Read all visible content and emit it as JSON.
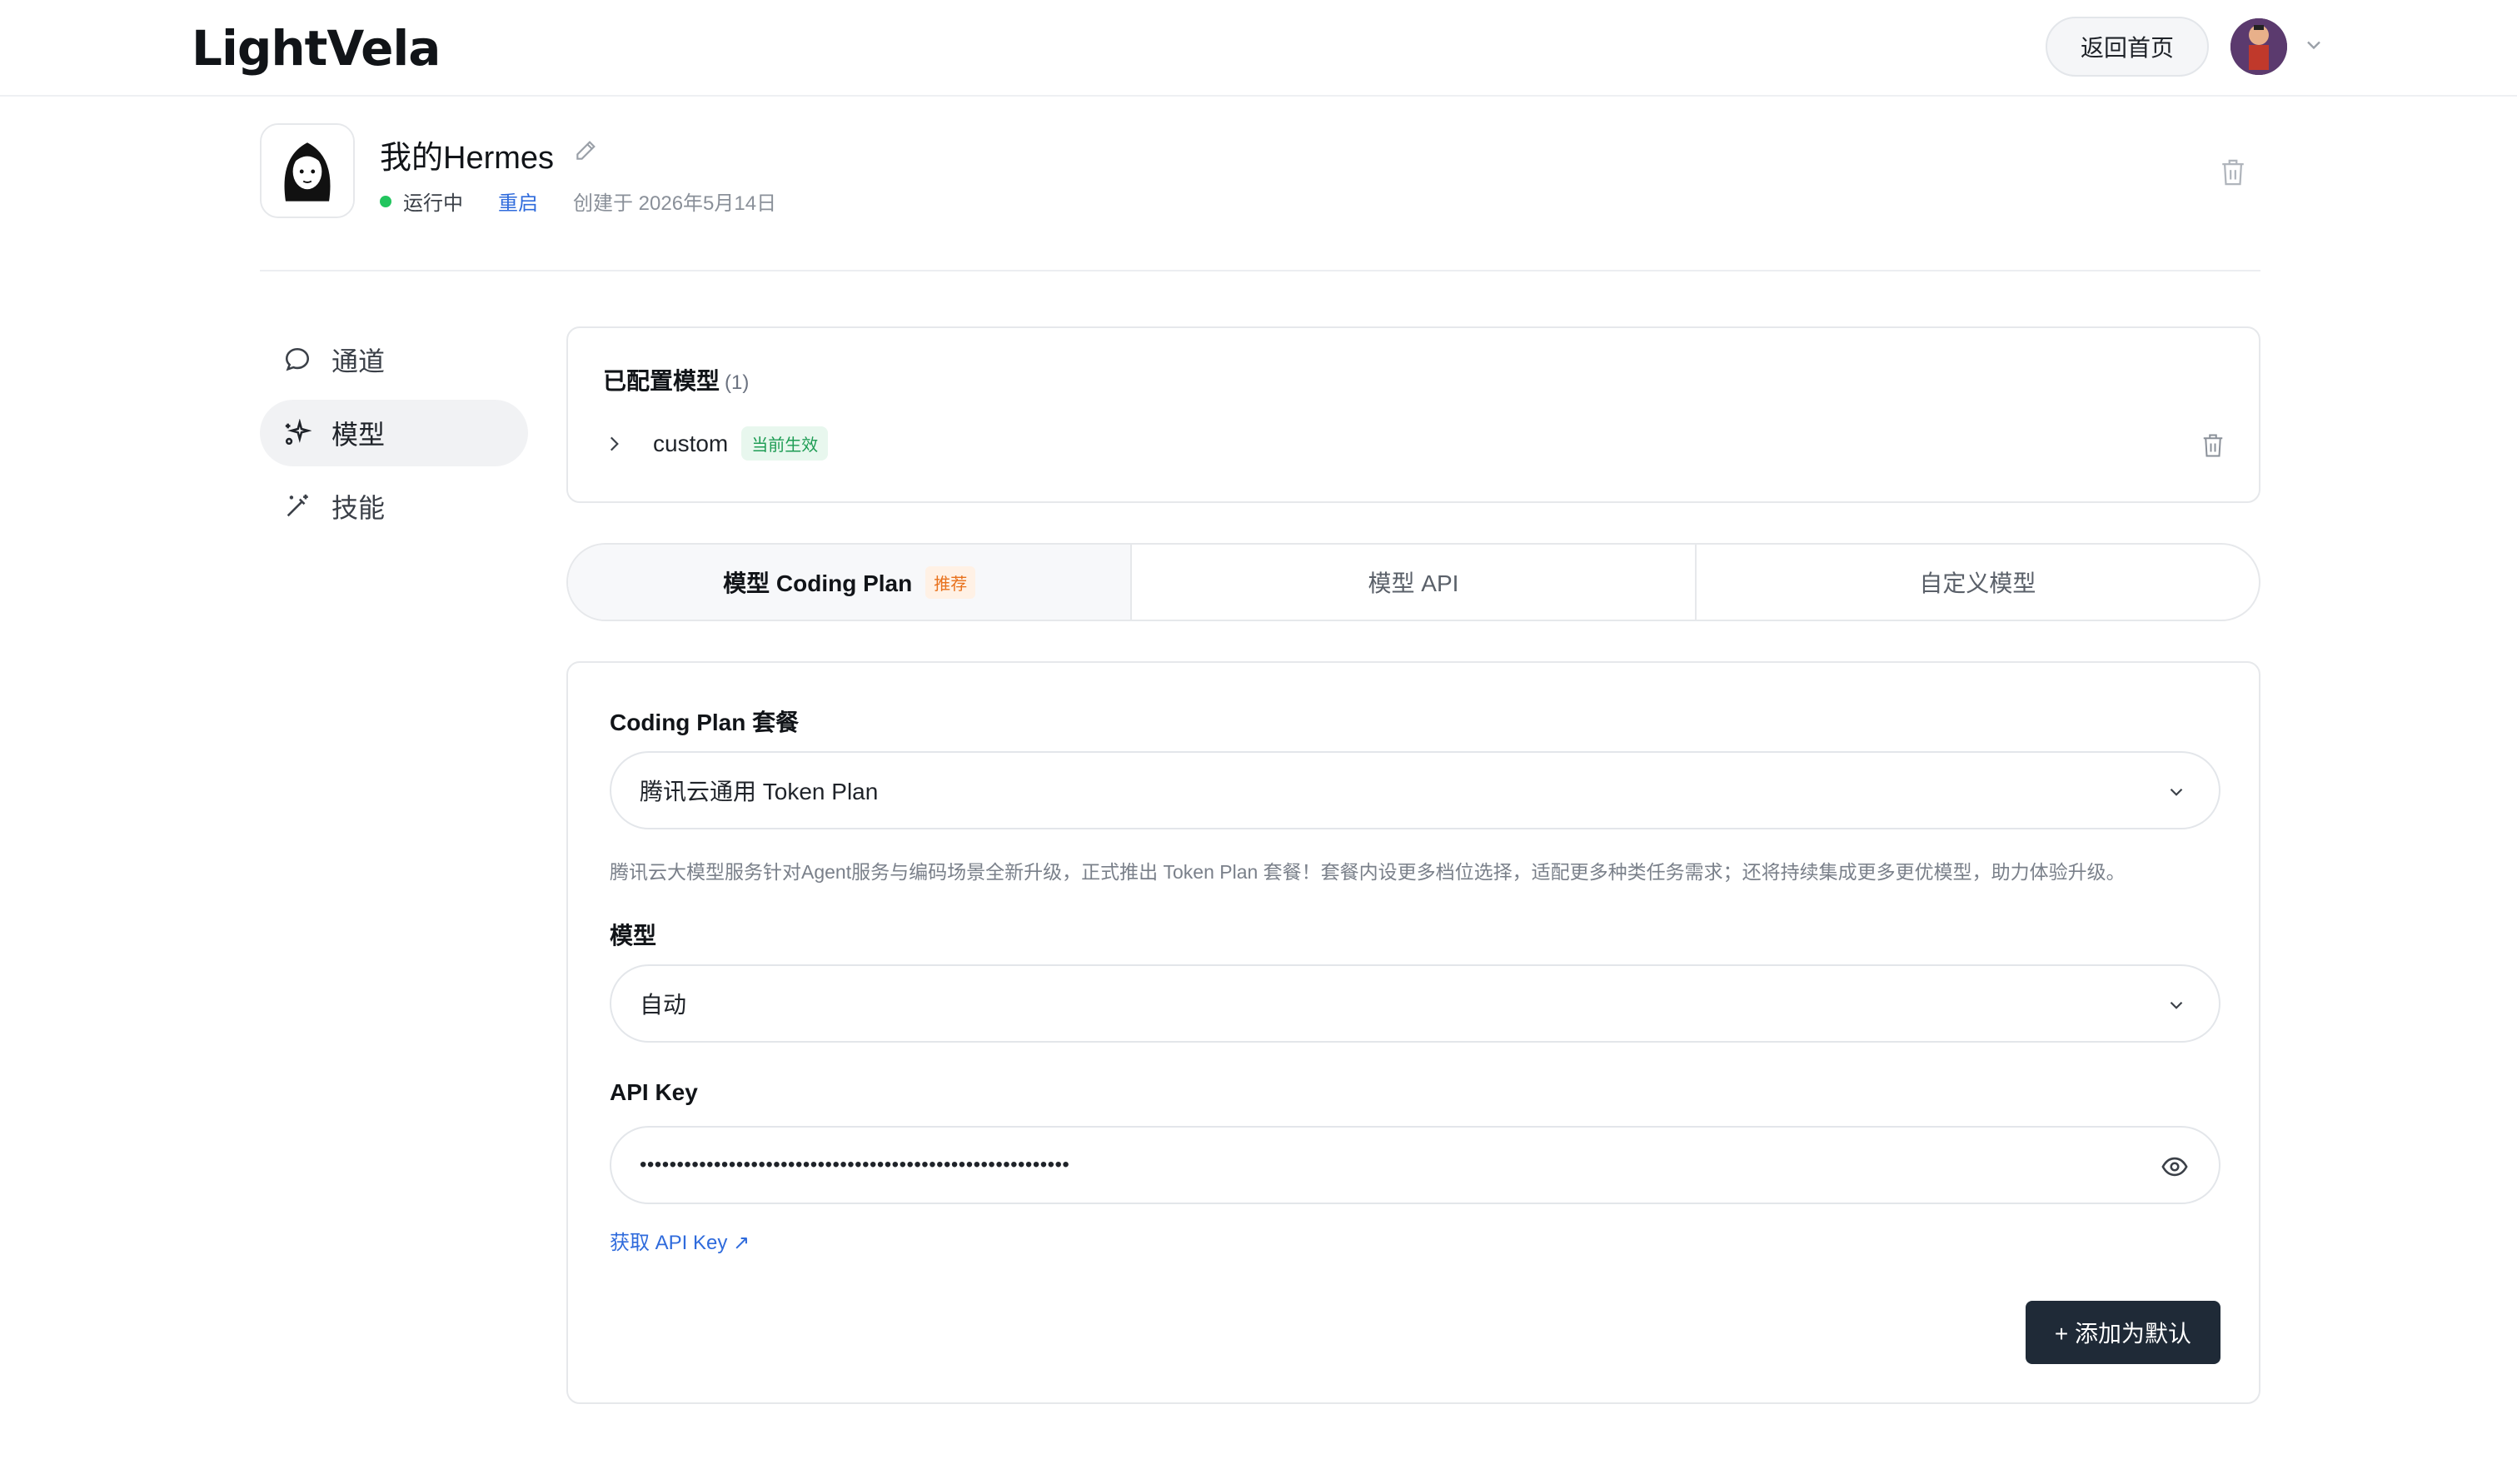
{
  "header": {
    "logo": "LightVela",
    "home_label": "返回首页"
  },
  "profile": {
    "name": "我的Hermes",
    "status": "运行中",
    "restart_label": "重启",
    "created": "创建于 2026年5月14日"
  },
  "sidebar": {
    "items": [
      {
        "label": "通道",
        "icon": "chat-bubble-icon",
        "active": false
      },
      {
        "label": "模型",
        "icon": "sparkle-icon",
        "active": true
      },
      {
        "label": "技能",
        "icon": "magic-wand-icon",
        "active": false
      }
    ]
  },
  "configured": {
    "title": "已配置模型",
    "count": "(1)",
    "models": [
      {
        "name": "custom",
        "badge": "当前生效"
      }
    ]
  },
  "tabs": [
    {
      "label": "模型 Coding Plan",
      "badge": "推荐",
      "active": true
    },
    {
      "label": "模型 API",
      "active": false
    },
    {
      "label": "自定义模型",
      "active": false
    }
  ],
  "form": {
    "plan_label": "Coding Plan 套餐",
    "plan_value": "腾讯云通用 Token Plan",
    "plan_help": "腾讯云大模型服务针对Agent服务与编码场景全新升级，正式推出 Token Plan 套餐！套餐内设更多档位选择，适配更多种类任务需求；还将持续集成更多更优模型，助力体验升级。",
    "model_label": "模型",
    "model_value": "自动",
    "api_key_label": "API Key",
    "api_key_value": "••••••••••••••••••••••••••••••••••••••••••••••••••••••••••",
    "get_key_label": "获取 API Key ↗",
    "add_default_label": "+ 添加为默认"
  },
  "colors": {
    "accent_link": "#2f6bdc",
    "status_green": "#22c55e",
    "primary_button": "#1f2a37",
    "recommend_badge": "#e8711c"
  }
}
